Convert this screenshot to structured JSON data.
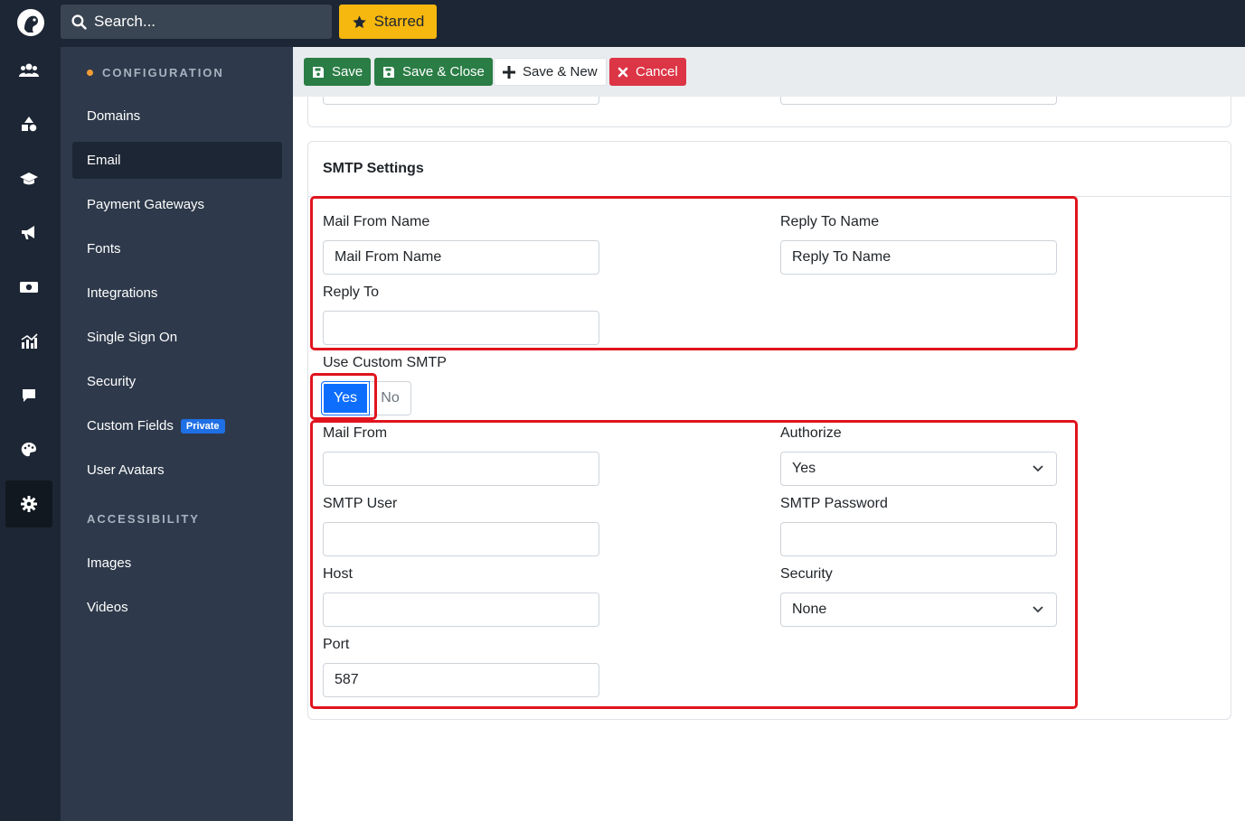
{
  "topbar": {
    "search_placeholder": "Search...",
    "starred_label": "Starred"
  },
  "rail": {
    "icons": [
      "users-icon",
      "shapes-icon",
      "graduation-cap-icon",
      "megaphone-icon",
      "money-icon",
      "chart-icon",
      "comment-icon",
      "palette-icon",
      "gear-icon"
    ],
    "active": "gear-icon"
  },
  "sidebar": {
    "config_heading": "CONFIGURATION",
    "items": [
      {
        "label": "Domains"
      },
      {
        "label": "Email",
        "active": true
      },
      {
        "label": "Payment Gateways"
      },
      {
        "label": "Fonts"
      },
      {
        "label": "Integrations"
      },
      {
        "label": "Single Sign On"
      },
      {
        "label": "Security"
      },
      {
        "label": "Custom Fields",
        "badge": "Private"
      },
      {
        "label": "User Avatars"
      }
    ],
    "accessibility_heading": "ACCESSIBILITY",
    "accessibility_items": [
      {
        "label": "Images"
      },
      {
        "label": "Videos"
      }
    ]
  },
  "toolbar": {
    "save": "Save",
    "save_close": "Save & Close",
    "save_new": "Save & New",
    "cancel": "Cancel"
  },
  "smtp": {
    "title": "SMTP Settings",
    "mail_from_name": {
      "label": "Mail From Name",
      "placeholder": "Mail From Name"
    },
    "reply_to_name": {
      "label": "Reply To Name",
      "placeholder": "Reply To Name"
    },
    "reply_to": {
      "label": "Reply To",
      "value": ""
    },
    "use_custom_smtp": {
      "label": "Use Custom SMTP",
      "yes": "Yes",
      "no": "No",
      "selected": "Yes"
    },
    "mail_from": {
      "label": "Mail From",
      "value": ""
    },
    "authorize": {
      "label": "Authorize",
      "value": "Yes"
    },
    "smtp_user": {
      "label": "SMTP User",
      "value": ""
    },
    "smtp_password": {
      "label": "SMTP Password",
      "value": ""
    },
    "host": {
      "label": "Host",
      "value": ""
    },
    "security": {
      "label": "Security",
      "value": "None"
    },
    "port": {
      "label": "Port",
      "value": "587"
    }
  },
  "colors": {
    "highlight": "#e0141e",
    "primary": "#0d6efd",
    "success": "#2a7d45",
    "danger": "#dc3545",
    "starred": "#f6b70e"
  }
}
